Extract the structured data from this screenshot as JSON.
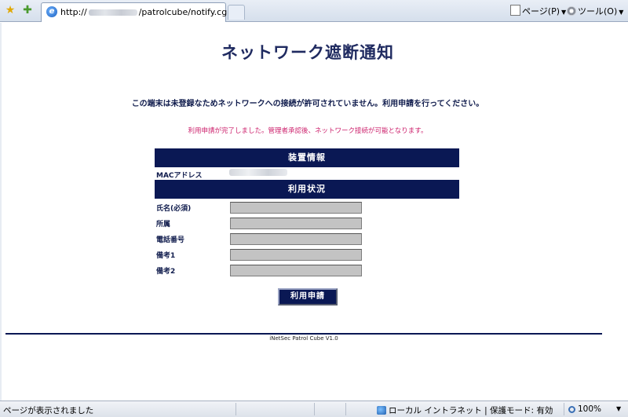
{
  "browser": {
    "tab_url_prefix": "http://",
    "tab_url_suffix": "/patrolcube/notify.cgi",
    "page_menu_label": "ページ(P)",
    "tools_menu_label": "ツール(O)",
    "menu_arrow": "▼",
    "favorites_icon": "star-icon",
    "add_favorite_icon": "star-plus-icon"
  },
  "page": {
    "title": "ネットワーク遮断通知",
    "notice": "この端末は未登録なためネットワークへの接続が許可されていません。利用申請を行ってください。",
    "status_message": "利用申請が完了しました。管理者承認後、ネットワーク接続が可能となります。",
    "device_section_title": "装置情報",
    "mac_label": "MACアドレス",
    "usage_section_title": "利用状況",
    "fields": [
      {
        "label": "氏名(必須)",
        "value": ""
      },
      {
        "label": "所属",
        "value": ""
      },
      {
        "label": "電話番号",
        "value": ""
      },
      {
        "label": "備考1",
        "value": ""
      },
      {
        "label": "備考2",
        "value": ""
      }
    ],
    "submit_label": "利用申請",
    "footer": "iNetSec Patrol Cube V1.0"
  },
  "statusbar": {
    "left_text": "ページが表示されました",
    "zone_text": "ローカル イントラネット | 保護モード: 有効",
    "zoom_text": "100%",
    "zoom_caret": "▼"
  },
  "colors": {
    "section_bar": "#0a1854",
    "title_text": "#1f2a60",
    "status_text": "#cc1f6b",
    "input_bg": "#c3c3c3"
  }
}
